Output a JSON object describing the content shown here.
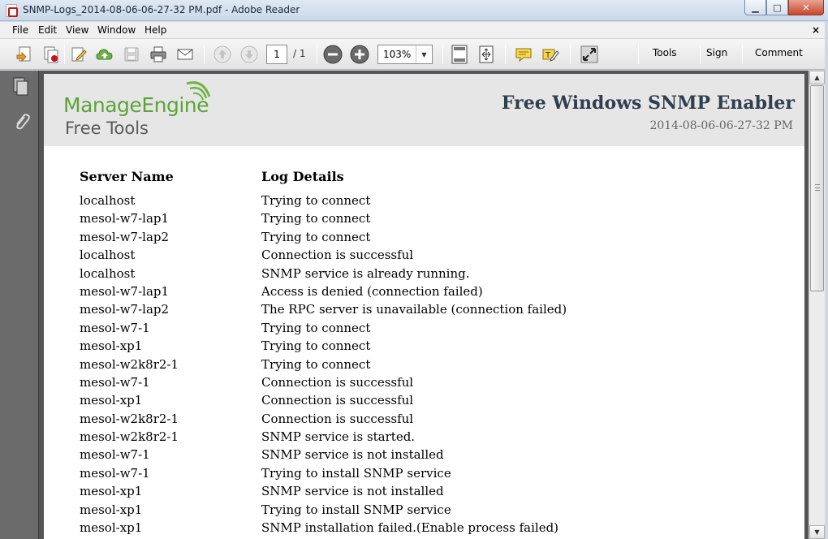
{
  "window": {
    "title": "SNMP-Logs_2014-08-06-06-27-32 PM.pdf - Adobe Reader",
    "minimize": "▁",
    "maximize": "□",
    "close": "✕"
  },
  "menu": {
    "items": [
      "File",
      "Edit",
      "View",
      "Window",
      "Help"
    ],
    "close_doc": "×"
  },
  "toolbar": {
    "page_current": "1",
    "page_total": "/ 1",
    "zoom": "103%",
    "links": [
      "Tools",
      "Sign",
      "Comment"
    ],
    "link_color": "#3c6ea1"
  },
  "document": {
    "logo": {
      "brand_manage": "Manage",
      "brand_engine": "Engine",
      "brand_sub": "Free Tools",
      "brand_color": "#5ea33a"
    },
    "title": "Free Windows SNMP Enabler",
    "date": "2014-08-06-06-27-32 PM",
    "table": {
      "headers": [
        "Server Name",
        "Log Details"
      ],
      "rows": [
        [
          "localhost",
          "Trying to connect"
        ],
        [
          "mesol-w7-lap1",
          "Trying to connect"
        ],
        [
          "mesol-w7-lap2",
          "Trying to connect"
        ],
        [
          "localhost",
          "Connection is successful"
        ],
        [
          "localhost",
          "SNMP service is already running."
        ],
        [
          "mesol-w7-lap1",
          "Access is denied (connection failed)"
        ],
        [
          "mesol-w7-lap2",
          "The RPC server is unavailable (connection failed)"
        ],
        [
          "mesol-w7-1",
          "Trying to connect"
        ],
        [
          "mesol-xp1",
          "Trying to connect"
        ],
        [
          "mesol-w2k8r2-1",
          "Trying to connect"
        ],
        [
          "mesol-w7-1",
          "Connection is successful"
        ],
        [
          "mesol-xp1",
          "Connection is successful"
        ],
        [
          "mesol-w2k8r2-1",
          "Connection is successful"
        ],
        [
          "mesol-w2k8r2-1",
          "SNMP service is started."
        ],
        [
          "mesol-w7-1",
          "SNMP service is not installed"
        ],
        [
          "mesol-w7-1",
          "Trying to install SNMP service"
        ],
        [
          "mesol-xp1",
          "SNMP service is not installed"
        ],
        [
          "mesol-xp1",
          "Trying to install SNMP service"
        ],
        [
          "mesol-xp1",
          "SNMP installation failed.(Enable process failed)"
        ]
      ]
    }
  }
}
